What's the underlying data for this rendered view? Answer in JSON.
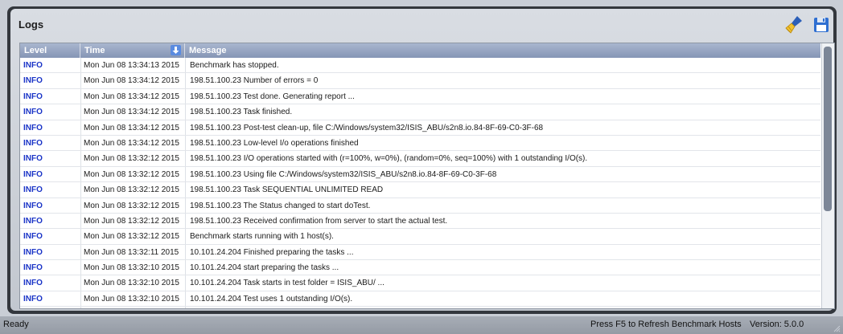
{
  "panel": {
    "title": "Logs"
  },
  "toolbar": {
    "clear_icon": "broom-icon",
    "save_icon": "floppy-disk-icon"
  },
  "table": {
    "columns": [
      "Level",
      "Time",
      "Message"
    ],
    "sort_icon": "sort-arrow-down-icon",
    "rows": [
      {
        "level": "INFO",
        "time": "Mon Jun 08 13:34:13 2015",
        "message": "Benchmark has stopped."
      },
      {
        "level": "INFO",
        "time": "Mon Jun 08 13:34:12 2015",
        "message": "198.51.100.23 Number of errors = 0"
      },
      {
        "level": "INFO",
        "time": "Mon Jun 08 13:34:12 2015",
        "message": "198.51.100.23 Test done. Generating report ..."
      },
      {
        "level": "INFO",
        "time": "Mon Jun 08 13:34:12 2015",
        "message": "198.51.100.23 Task finished."
      },
      {
        "level": "INFO",
        "time": "Mon Jun 08 13:34:12 2015",
        "message": "198.51.100.23 Post-test clean-up, file C:/Windows/system32/ISIS_ABU/s2n8.io.84-8F-69-C0-3F-68"
      },
      {
        "level": "INFO",
        "time": "Mon Jun 08 13:34:12 2015",
        "message": "198.51.100.23 Low-level I/o operations finished"
      },
      {
        "level": "INFO",
        "time": "Mon Jun 08 13:32:12 2015",
        "message": "198.51.100.23 I/O operations started with (r=100%, w=0%), (random=0%, seq=100%) with 1 outstanding I/O(s)."
      },
      {
        "level": "INFO",
        "time": "Mon Jun 08 13:32:12 2015",
        "message": "198.51.100.23 Using file C:/Windows/system32/ISIS_ABU/s2n8.io.84-8F-69-C0-3F-68"
      },
      {
        "level": "INFO",
        "time": "Mon Jun 08 13:32:12 2015",
        "message": "198.51.100.23 Task   SEQUENTIAL   UNLIMITED   READ"
      },
      {
        "level": "INFO",
        "time": "Mon Jun 08 13:32:12 2015",
        "message": "198.51.100.23 The Status changed to start doTest."
      },
      {
        "level": "INFO",
        "time": "Mon Jun 08 13:32:12 2015",
        "message": "198.51.100.23 Received confirmation from server to start the actual test."
      },
      {
        "level": "INFO",
        "time": "Mon Jun 08 13:32:12 2015",
        "message": "Benchmark starts running with 1 host(s)."
      },
      {
        "level": "INFO",
        "time": "Mon Jun 08 13:32:11 2015",
        "message": "10.101.24.204 Finished preparing the tasks ..."
      },
      {
        "level": "INFO",
        "time": "Mon Jun 08 13:32:10 2015",
        "message": "10.101.24.204 start preparing the tasks ..."
      },
      {
        "level": "INFO",
        "time": "Mon Jun 08 13:32:10 2015",
        "message": "10.101.24.204 Task starts in test folder = ISIS_ABU/ ..."
      },
      {
        "level": "INFO",
        "time": "Mon Jun 08 13:32:10 2015",
        "message": "10.101.24.204 Test uses 1 outstanding I/O(s)."
      }
    ]
  },
  "statusbar": {
    "left": "Ready",
    "hint": "Press F5 to Refresh Benchmark Hosts",
    "version": "Version: 5.0.0"
  },
  "colors": {
    "level_info": "#1a34c7",
    "header": "#8595b5",
    "frame": "#33373d"
  }
}
